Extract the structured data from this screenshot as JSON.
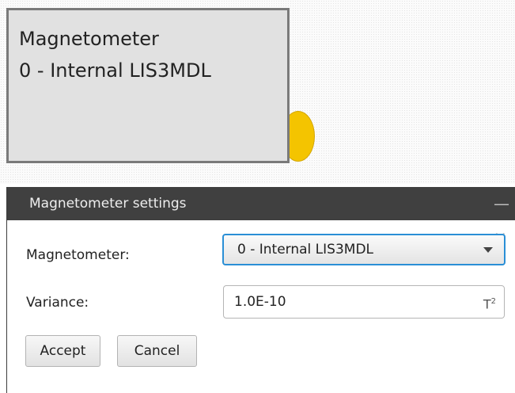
{
  "node": {
    "title": "Magnetometer",
    "subtitle": "0 - Internal LIS3MDL",
    "port_color": "#f4c400"
  },
  "dialog": {
    "title": "Magnetometer settings",
    "minimize_label": "—",
    "close_label": "×",
    "magnetometer_label": "Magnetometer:",
    "magnetometer_value": "0 - Internal LIS3MDL",
    "variance_label": "Variance:",
    "variance_value": "1.0E-10",
    "variance_unit": "T",
    "variance_unit_exp": "2",
    "accept_label": "Accept",
    "cancel_label": "Cancel",
    "accent_color": "#2a8fd6"
  }
}
